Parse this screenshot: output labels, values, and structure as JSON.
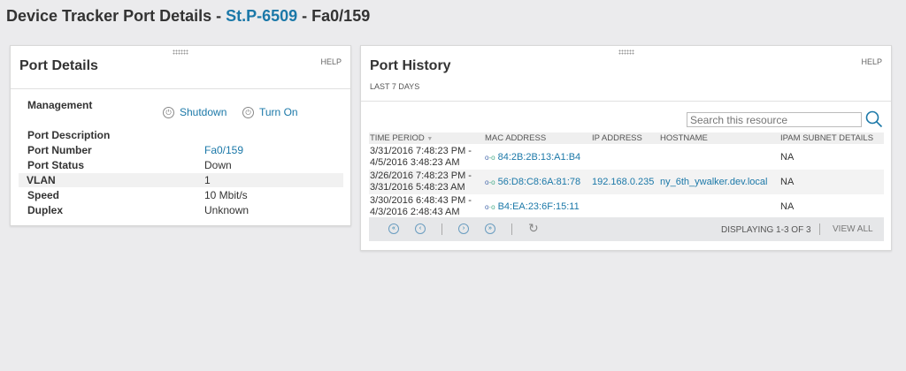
{
  "header": {
    "prefix": "Device Tracker Port Details - ",
    "device": "St.P-6509",
    "suffix": " - Fa0/159"
  },
  "port_details": {
    "title": "Port Details",
    "help": "HELP",
    "management_label": "Management",
    "shutdown": "Shutdown",
    "turn_on": "Turn On",
    "rows": [
      {
        "label": "Port Description",
        "value": ""
      },
      {
        "label": "Port Number",
        "value": "Fa0/159"
      },
      {
        "label": "Port Status",
        "value": "Down"
      },
      {
        "label": "VLAN",
        "value": "1"
      },
      {
        "label": "Speed",
        "value": "10 Mbit/s"
      },
      {
        "label": "Duplex",
        "value": "Unknown"
      }
    ]
  },
  "port_history": {
    "title": "Port History",
    "subtitle": "LAST 7 DAYS",
    "help": "HELP",
    "search_placeholder": "Search this resource",
    "columns": [
      "TIME PERIOD",
      "MAC ADDRESS",
      "IP ADDRESS",
      "HOSTNAME",
      "IPAM SUBNET DETAILS"
    ],
    "rows": [
      {
        "time1": "3/31/2016 7:48:23 PM -",
        "time2": "4/5/2016 3:48:23 AM",
        "mac": "84:2B:2B:13:A1:B4",
        "ip": "",
        "host": "",
        "ipam": "NA"
      },
      {
        "time1": "3/26/2016 7:48:23 PM -",
        "time2": "3/31/2016 5:48:23 AM",
        "mac": "56:D8:C8:6A:81:78",
        "ip": "192.168.0.235",
        "host": "ny_6th_ywalker.dev.local",
        "ipam": "NA"
      },
      {
        "time1": "3/30/2016 6:48:43 PM -",
        "time2": "4/3/2016 2:48:43 AM",
        "mac": "B4:EA:23:6F:15:11",
        "ip": "",
        "host": "",
        "ipam": "NA"
      }
    ],
    "displaying": "DISPLAYING 1-3 OF 3",
    "view_all": "VIEW ALL"
  }
}
